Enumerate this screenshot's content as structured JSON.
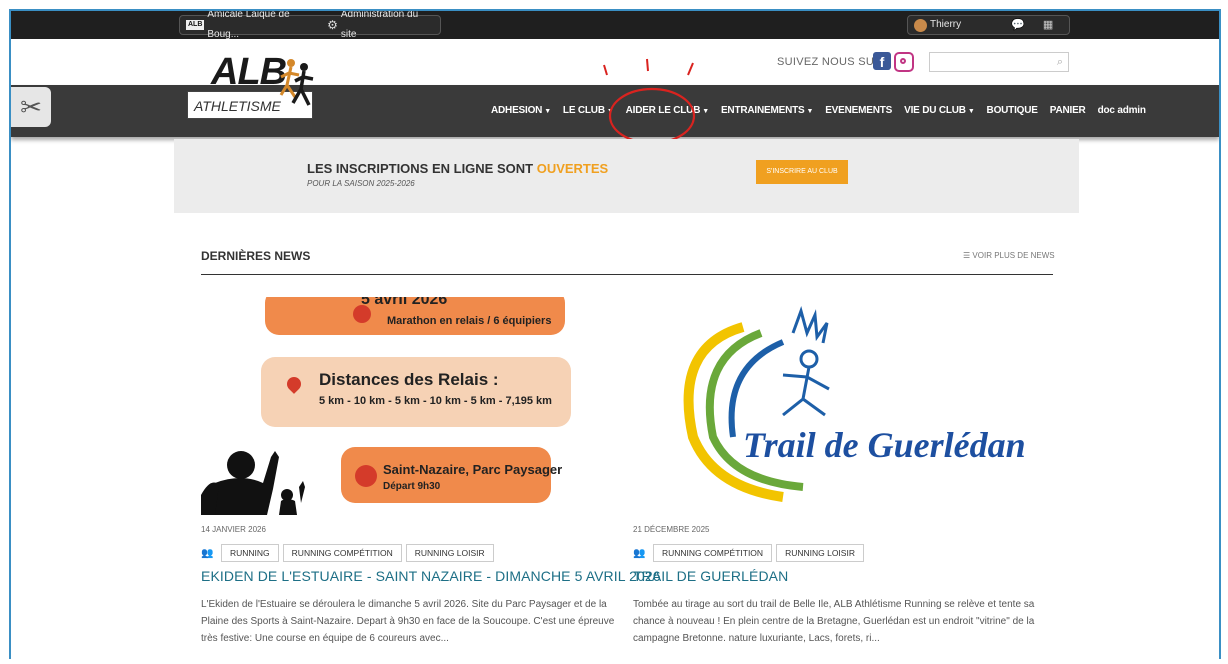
{
  "admin_bar": {
    "site_name": "Amicale Laique de Boug...",
    "admin_link": "Administration du site",
    "user_name": "Thierry",
    "logo_mini": "ALB"
  },
  "header": {
    "logo_main": "ALB",
    "logo_sub": "ATHLETISME",
    "follow_label": "SUIVEZ NOUS SUR",
    "facebook_letter": "f",
    "search_placeholder": ""
  },
  "nav": {
    "items": [
      {
        "label": "ADHESION",
        "dropdown": true
      },
      {
        "label": "LE CLUB",
        "dropdown": true
      },
      {
        "label": "AIDER LE CLUB",
        "dropdown": true
      },
      {
        "label": "ENTRAINEMENTS",
        "dropdown": true
      },
      {
        "label": "EVENEMENTS",
        "dropdown": false
      },
      {
        "label": "VIE DU CLUB",
        "dropdown": true
      },
      {
        "label": "BOUTIQUE",
        "dropdown": false
      },
      {
        "label": "PANIER",
        "dropdown": false
      },
      {
        "label": "doc admin",
        "dropdown": false
      }
    ]
  },
  "banner": {
    "title_start": "LES INSCRIPTIONS EN LIGNE SONT ",
    "title_highlight": "OUVERTES",
    "subtitle": "POUR LA SAISON 2025-2026",
    "button": "S'INSCRIRE AU CLUB"
  },
  "news": {
    "heading": "DERNIÈRES NEWS",
    "more_link": "VOIR PLUS DE NEWS",
    "articles": [
      {
        "date": "14 JANVIER 2026",
        "tags": [
          "RUNNING",
          "RUNNING COMPÉTITION",
          "RUNNING LOISIR"
        ],
        "title": "EKIDEN DE L'ESTUAIRE - SAINT NAZAIRE - DIMANCHE 5 AVRIL 2026",
        "excerpt": "L'Ekiden de l'Estuaire se déroulera le dimanche 5 avril 2026. Site du Parc Paysager et de la Plaine des Sports à Saint-Nazaire. Depart à 9h30 en face de la Soucoupe. C'est une épreuve très festive: Une course en équipe de 6 coureurs avec...",
        "image": {
          "line1a": "5 avril 2026",
          "line1b": "Marathon en relais / 6 équipiers",
          "line2a": "Distances des Relais :",
          "line2b": "5 km - 10 km - 5 km - 10 km - 5 km - 7,195 km",
          "line3a": "Saint-Nazaire, Parc Paysager",
          "line3b": "Départ 9h30"
        }
      },
      {
        "date": "21 DÉCEMBRE 2025",
        "tags": [
          "RUNNING COMPÉTITION",
          "RUNNING LOISIR"
        ],
        "title": "TRAIL DE GUERLÉDAN",
        "excerpt": "Tombée au tirage au sort du trail de Belle Ile, ALB Athlétisme Running se relève et tente sa chance à nouveau !  En plein centre de la Bretagne, Guerlédan est un endroit \"vitrine\" de la campagne Bretonne. nature luxuriante, Lacs, forets, ri...",
        "image": {
          "logo_text": "Trail de Guerlédan"
        }
      }
    ]
  },
  "colors": {
    "accent": "#f0a020",
    "nav_bg": "#3a3a3a",
    "title_link": "#1d6f86",
    "annotation": "#d9231f"
  }
}
